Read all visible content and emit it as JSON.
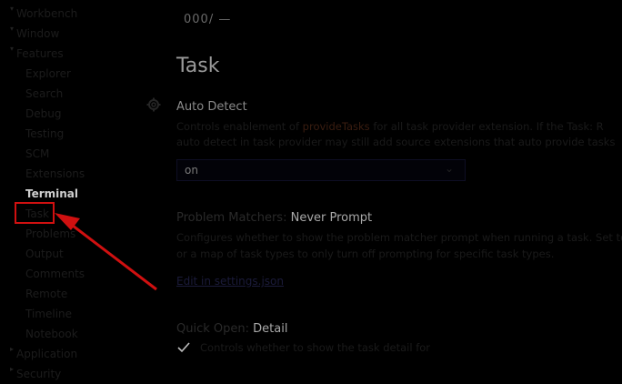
{
  "sidebar": {
    "items": [
      {
        "label": "Workbench",
        "indent": 0,
        "expanded": true
      },
      {
        "label": "Window",
        "indent": 0,
        "expanded": true
      },
      {
        "label": "Features",
        "indent": 0,
        "expanded": true
      },
      {
        "label": "Explorer",
        "indent": 1
      },
      {
        "label": "Search",
        "indent": 1
      },
      {
        "label": "Debug",
        "indent": 1
      },
      {
        "label": "Testing",
        "indent": 1
      },
      {
        "label": "SCM",
        "indent": 1
      },
      {
        "label": "Extensions",
        "indent": 1
      },
      {
        "label": "Terminal",
        "indent": 1,
        "active": true
      },
      {
        "label": "Task",
        "indent": 1
      },
      {
        "label": "Problems",
        "indent": 1
      },
      {
        "label": "Output",
        "indent": 1
      },
      {
        "label": "Comments",
        "indent": 1
      },
      {
        "label": "Remote",
        "indent": 1
      },
      {
        "label": "Timeline",
        "indent": 1
      },
      {
        "label": "Notebook",
        "indent": 1
      },
      {
        "label": "Application",
        "indent": 0,
        "expanded": false
      },
      {
        "label": "Security",
        "indent": 0,
        "expanded": false
      }
    ]
  },
  "breadcrumb": "000/ —",
  "section_title": "Task",
  "auto_detect": {
    "label": "Auto Detect",
    "desc_line1_prefix": "Controls enablement of ",
    "desc_code": "provideTasks",
    "desc_line1_suffix": " for all task provider extension. If the Task: R",
    "desc_line2": "auto detect in task provider may still add source extensions that auto provide tasks",
    "value": "on"
  },
  "problem_matchers": {
    "category": "Problem Matchers:",
    "label": "Never Prompt",
    "desc_line1": "Configures whether to show the problem matcher prompt when running a task. Set to",
    "desc_line2": "or a map of task types to only turn off prompting for specific task types.",
    "link": "Edit in settings.json"
  },
  "quick_open": {
    "category": "Quick Open:",
    "label": "Detail",
    "checked": true,
    "desc": "Controls whether to show the task detail for"
  },
  "colors": {
    "annotation": "#d01010",
    "active_text": "#cfcfcf",
    "background": "#000000"
  }
}
